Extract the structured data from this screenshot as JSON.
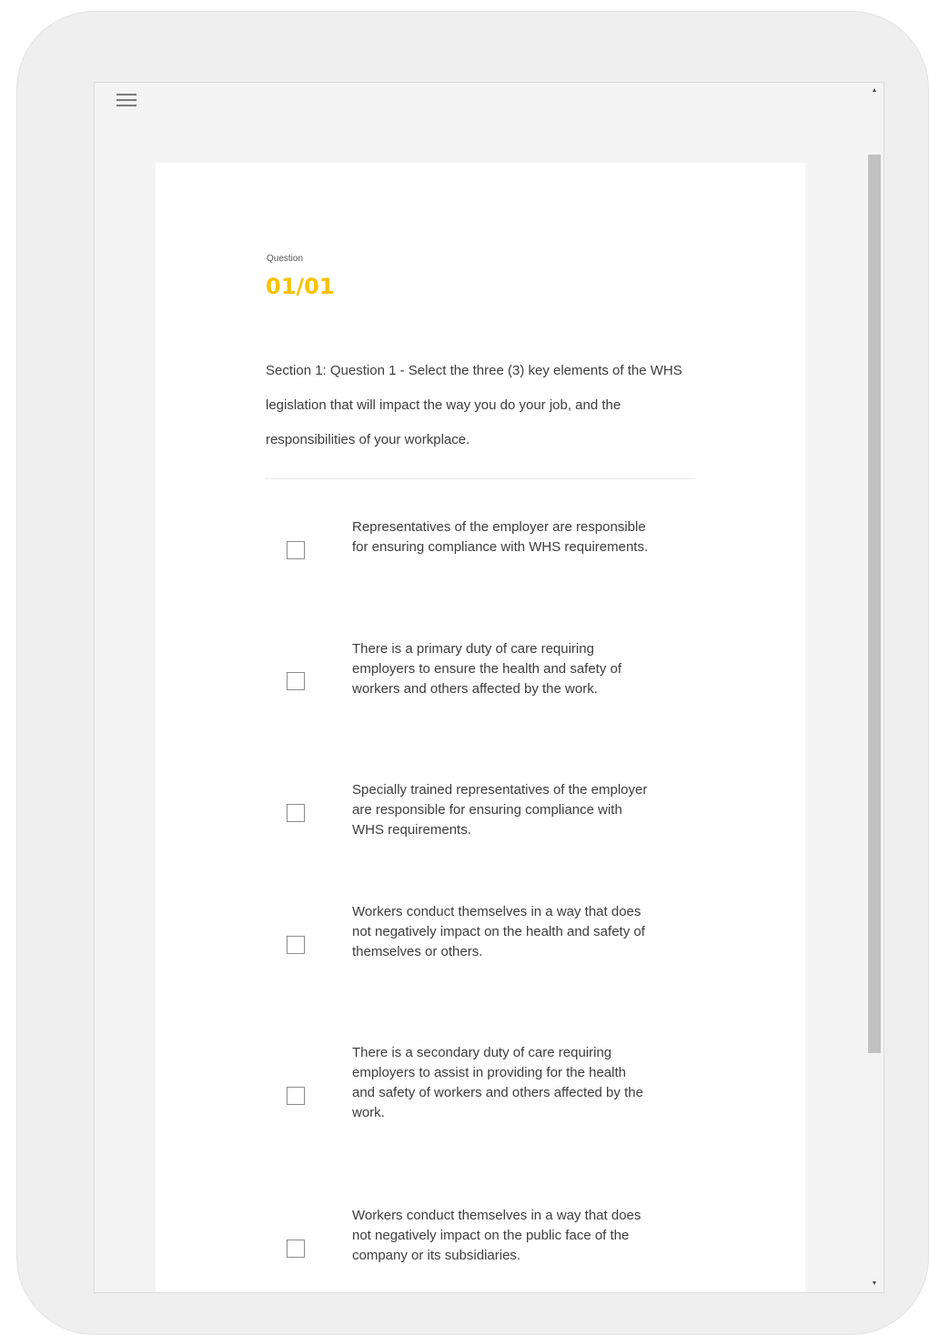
{
  "menu": {
    "icon": "hamburger-menu-icon"
  },
  "question": {
    "label": "Question",
    "number": "01/01",
    "text": "Section 1: Question 1 - Select the three (3) key elements of the WHS legislation that will impact the way you do your job, and the responsibilities of your workplace."
  },
  "options": [
    {
      "text": "Representatives of the employer are responsible for ensuring compliance with WHS requirements.",
      "checked": false
    },
    {
      "text": "There is a primary duty of care requiring employers to ensure the health and safety of workers and others affected by the work.",
      "checked": false
    },
    {
      "text": "Specially trained representatives of the employer are responsible for ensuring compliance with WHS requirements.",
      "checked": false
    },
    {
      "text": "Workers conduct themselves in a way that does not negatively impact on the health and safety of themselves or others.",
      "checked": false
    },
    {
      "text": "There is a secondary duty of care requiring employers to assist in providing for the health and safety of workers and others affected by the work.",
      "checked": false
    },
    {
      "text": "Workers conduct themselves in a way that does not negatively impact on the public face of the company or its subsidiaries.",
      "checked": false
    }
  ],
  "scrollbar": {
    "up_icon": "▲",
    "down_icon": "▼"
  }
}
